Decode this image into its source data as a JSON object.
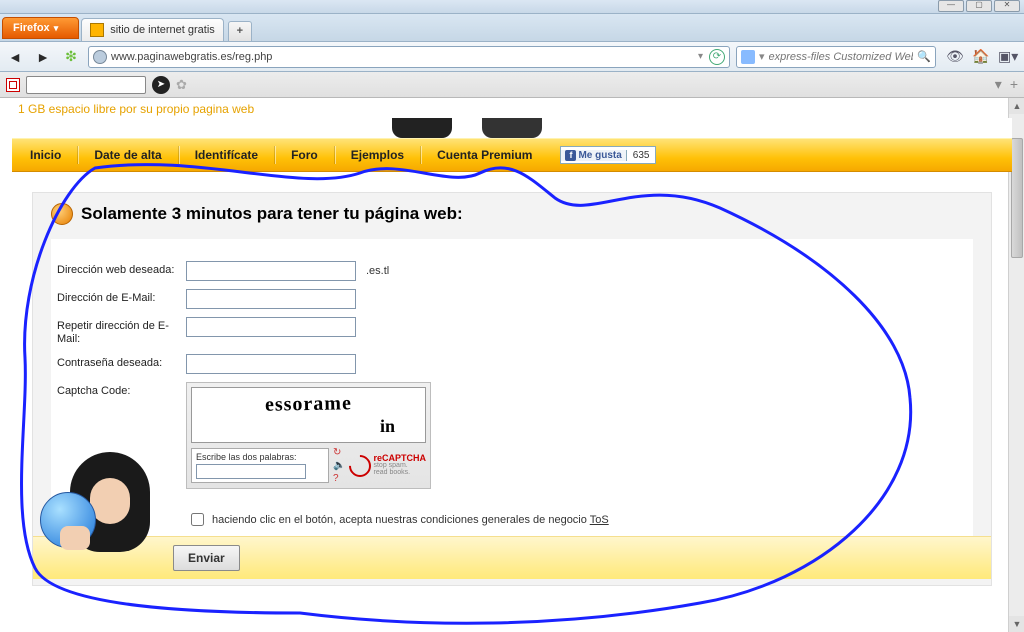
{
  "browser": {
    "name": "Firefox",
    "tab_title": "sitio de internet gratis",
    "url": "www.paginawebgratis.es/reg.php",
    "search_placeholder": "express-files Customized Web Search",
    "search_icon_label": "🔍"
  },
  "page": {
    "slogan": "1 GB espacio libre por su propio pagina web",
    "menu": {
      "items": [
        "Inicio",
        "Date de alta",
        "Identifícate",
        "Foro",
        "Ejemplos",
        "Cuenta Premium"
      ],
      "fb_like_label": "Me gusta",
      "fb_like_count": "635"
    },
    "panel_headline": "Solamente 3 minutos para tener tu página web:",
    "form": {
      "labels": {
        "address": "Dirección web deseada:",
        "address_suffix": ".es.tl",
        "email": "Dirección de E-Mail:",
        "email_repeat": "Repetir dirección de E-Mail:",
        "password": "Contraseña deseada:",
        "captcha": "Captcha Code:"
      },
      "captcha": {
        "word1": "essorame",
        "word2": "in",
        "entry_label": "Escribe las dos palabras:",
        "brand_main": "reCAPTCHA",
        "brand_sub1": "stop spam.",
        "brand_sub2": "read books."
      },
      "tos_text_before": "haciendo clic en el botón, acepta nuestras condiciones generales de negocio ",
      "tos_link": "ToS",
      "submit": "Enviar"
    }
  }
}
